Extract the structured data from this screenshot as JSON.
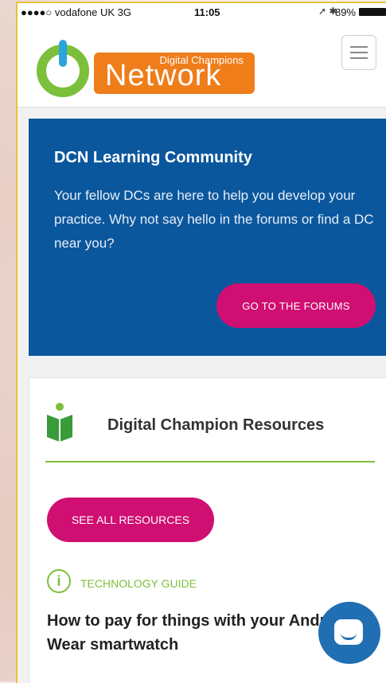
{
  "status_bar": {
    "carrier": "●●●●○ vodafone UK  3G",
    "time": "11:05",
    "signal_icons": "➚ ✱",
    "battery": "89%"
  },
  "header": {
    "logo_sub": "Digital Champions",
    "logo_main": "Network"
  },
  "community_card": {
    "title": "DCN Learning Community",
    "body": "Your fellow DCs are here to help you develop your practice. Why not say hello in the forums or find a DC near you?",
    "button_label": "GO TO THE FORUMS"
  },
  "resources_card": {
    "title": "Digital Champion Resources",
    "button_label": "SEE ALL RESOURCES",
    "info_icon_glyph": "i",
    "guide_label": "TECHNOLOGY GUIDE",
    "article_title": "How to pay for things with your Android Wear smartwatch"
  },
  "colors": {
    "accent_magenta": "#cf0f72",
    "community_blue": "#0b579e",
    "brand_green": "#7cbf3a",
    "brand_orange": "#ef7d1a"
  }
}
